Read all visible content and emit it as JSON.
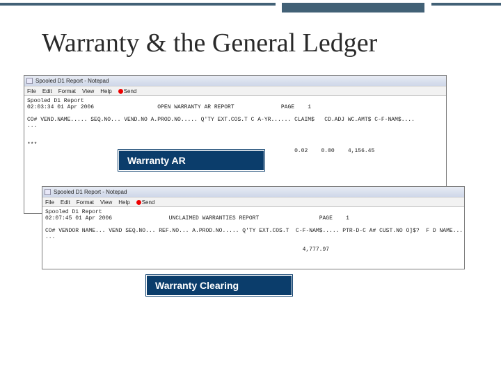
{
  "colors": {
    "accent": "#426176",
    "callout_bg": "#0b3d6b"
  },
  "title": "Warranty & the General Ledger",
  "notepad1": {
    "title": "Spooled D1 Report - Notepad",
    "menu": [
      "File",
      "Edit",
      "Format",
      "View",
      "Help"
    ],
    "send_label": "Send",
    "line1": "Spooled D1 Report",
    "line2": "02:03:34 01 Apr 2006",
    "report_title": "OPEN WARRANTY AR REPORT",
    "page_label": "PAGE",
    "page_no": "1",
    "columns": "CO# VEND.NAME..... SEQ.NO... VEND.NO A.PROD.NO..... Q'TY EXT.COS.T C A-YR...... CLAIM$   CD.ADJ WC.AMT$ C-F-NAM$....",
    "dots": "...",
    "end_marker": "***",
    "val1": "0.02",
    "val2": "0.00",
    "val3": "4,156.45"
  },
  "callout_ar": "Warranty AR",
  "notepad2": {
    "title": "Spooled D1 Report - Notepad",
    "menu": [
      "File",
      "Edit",
      "Format",
      "View",
      "Help"
    ],
    "send_label": "Send",
    "line1": "Spooled D1 Report",
    "line2": "02:07:45 01 Apr 2006",
    "report_title": "UNCLAIMED WARRANTIES REPORT",
    "page_label": "PAGE",
    "page_no": "1",
    "columns": "CO# VENDOR NAME... VEND SEQ.NO... REF.NO... A.PROD.NO..... Q'TY EXT.COS.T  C-F-NAM$..... PTR-D-C A# CUST.NO O]$?  F D NAME....",
    "dots": "...",
    "val1": "4,777.97"
  },
  "callout_clearing": "Warranty Clearing"
}
